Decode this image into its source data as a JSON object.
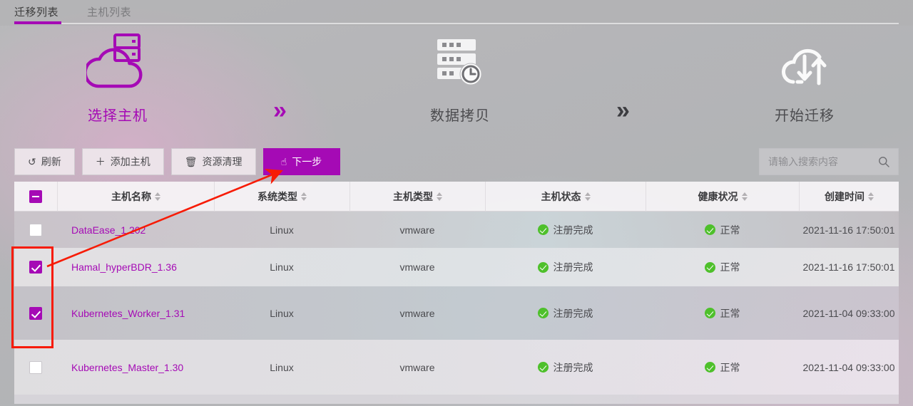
{
  "tabs": [
    {
      "label": "迁移列表",
      "active": true
    },
    {
      "label": "主机列表",
      "active": false
    }
  ],
  "steps": [
    {
      "label": "选择主机",
      "icon": "cloud-server-icon",
      "state": "active"
    },
    {
      "label": "数据拷贝",
      "icon": "server-clock-icon",
      "state": "inactive"
    },
    {
      "label": "开始迁移",
      "icon": "cloud-sync-icon",
      "state": "inactive"
    }
  ],
  "step_separator": "»",
  "toolbar": {
    "refresh_label": "刷新",
    "refresh_icon": "↺",
    "add_host_label": "添加主机",
    "add_host_icon": "＋",
    "cleanup_label": "资源清理",
    "cleanup_icon": "🗑",
    "next_label": "下一步",
    "next_icon": "☝"
  },
  "search": {
    "placeholder": "请输入搜索内容",
    "icon": "search-icon"
  },
  "table": {
    "select_all_state": "indeterminate",
    "columns": [
      {
        "key": "name",
        "label": "主机名称",
        "sortable": true
      },
      {
        "key": "os",
        "label": "系统类型",
        "sortable": true
      },
      {
        "key": "type",
        "label": "主机类型",
        "sortable": true
      },
      {
        "key": "stat",
        "label": "主机状态",
        "sortable": true
      },
      {
        "key": "heal",
        "label": "健康状况",
        "sortable": true
      },
      {
        "key": "time",
        "label": "创建时间",
        "sortable": true
      }
    ],
    "rows": [
      {
        "selected": false,
        "name": "DataEase_1.202",
        "os": "Linux",
        "type": "vmware",
        "status": "注册完成",
        "health": "正常",
        "created": "2021-11-16 17:50:01"
      },
      {
        "selected": true,
        "name": "Hamal_hyperBDR_1.36",
        "os": "Linux",
        "type": "vmware",
        "status": "注册完成",
        "health": "正常",
        "created": "2021-11-16 17:50:01"
      },
      {
        "selected": true,
        "name": "Kubernetes_Worker_1.31",
        "os": "Linux",
        "type": "vmware",
        "status": "注册完成",
        "health": "正常",
        "created": "2021-11-04 09:33:00"
      },
      {
        "selected": false,
        "name": "Kubernetes_Master_1.30",
        "os": "Linux",
        "type": "vmware",
        "status": "注册完成",
        "health": "正常",
        "created": "2021-11-04 09:33:00"
      }
    ]
  },
  "colors": {
    "accent_purple": "#a50ab5",
    "status_green": "#4ec02b",
    "annotation_red": "#f71b05"
  },
  "annotations": {
    "highlight_box": "checkbox-column-highlight",
    "arrow": "arrow-to-next-button"
  }
}
